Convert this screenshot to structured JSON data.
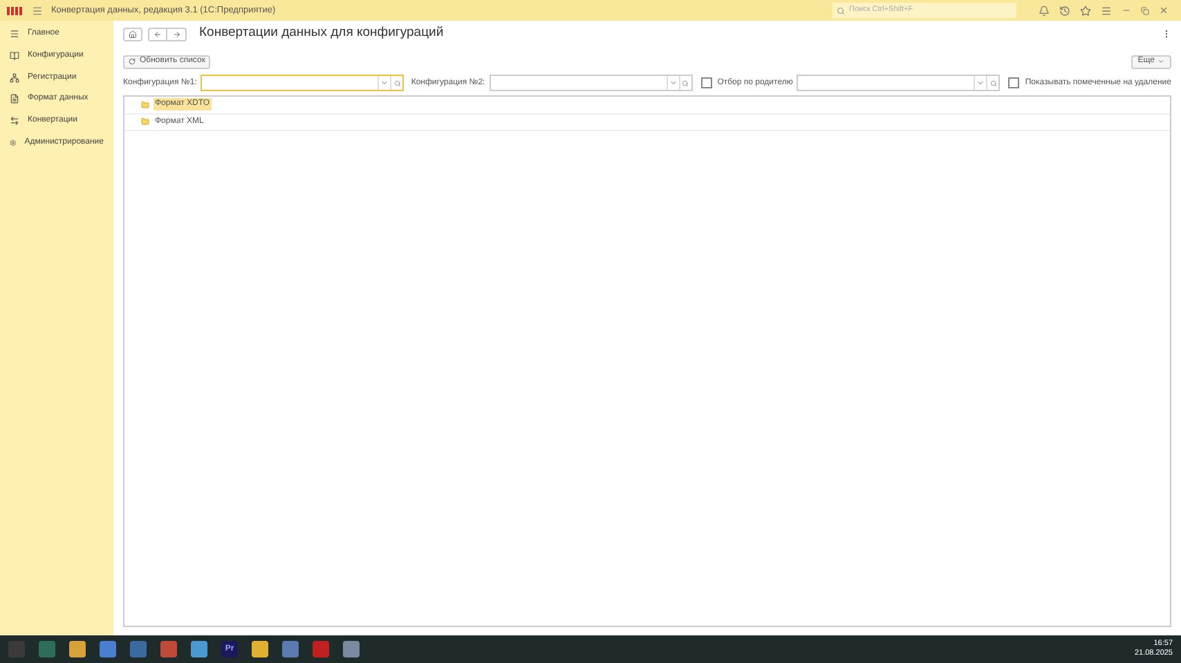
{
  "window": {
    "title": "Конвертация данных, редакция 3.1  (1С:Предприятие)",
    "search_placeholder": "Поиск Ctrl+Shift+F"
  },
  "sidebar": {
    "items": [
      {
        "label": "Главное",
        "kind": "menu"
      },
      {
        "label": "Конфигурации",
        "kind": "book"
      },
      {
        "label": "Регистрации",
        "kind": "tree"
      },
      {
        "label": "Формат данных",
        "kind": "doc"
      },
      {
        "label": "Конвертации",
        "kind": "swap"
      },
      {
        "label": "Администрирование",
        "kind": "gear"
      }
    ]
  },
  "page": {
    "title": "Конвертации данных для конфигураций",
    "refresh_button": "Обновить список",
    "more_button": "Еще",
    "filters": {
      "config1_label": "Конфигурация №1:",
      "config2_label": "Конфигурация №2:",
      "parent_filter": {
        "label": "Отбор по родителю",
        "checked": false
      },
      "show_deleted": {
        "label": "Показывать помеченные на удаление",
        "checked": false
      }
    },
    "tree": [
      {
        "label": "Формат XDTO",
        "selected": true
      },
      {
        "label": "Формат XML",
        "selected": false
      }
    ]
  },
  "taskbar": {
    "apps": [
      {
        "kind": "tile"
      },
      {
        "kind": "tile"
      },
      {
        "kind": "tile"
      },
      {
        "kind": "tile"
      },
      {
        "kind": "tile"
      },
      {
        "kind": "tile"
      },
      {
        "kind": "tile"
      },
      {
        "kind": "label",
        "label": "Pr"
      },
      {
        "kind": "tile"
      },
      {
        "kind": "tile"
      },
      {
        "kind": "tile"
      },
      {
        "kind": "tile"
      }
    ],
    "time": "16:57",
    "date": "21.08.2025"
  }
}
